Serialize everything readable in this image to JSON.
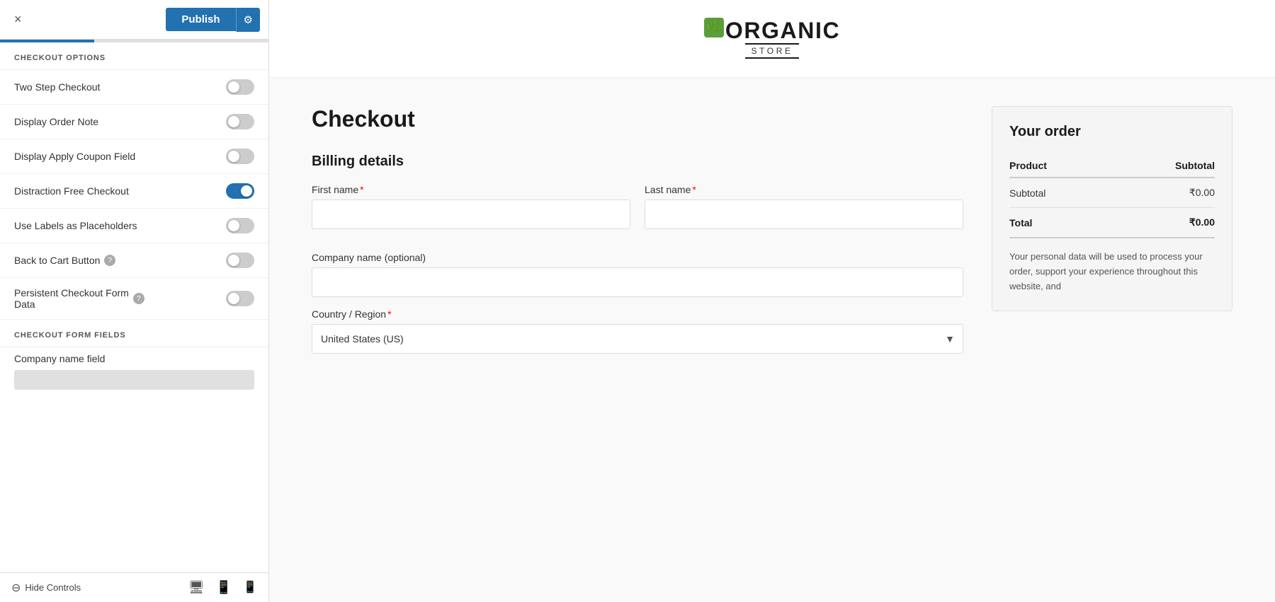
{
  "topbar": {
    "close_label": "×",
    "publish_label": "Publish",
    "gear_label": "⚙"
  },
  "sidebar": {
    "section1_title": "CHECKOUT OPTIONS",
    "section2_title": "CHECKOUT FORM FIELDS",
    "toggles": [
      {
        "id": "two-step",
        "label": "Two Step Checkout",
        "on": false,
        "help": false
      },
      {
        "id": "display-order-note",
        "label": "Display Order Note",
        "on": false,
        "help": false
      },
      {
        "id": "display-apply-coupon",
        "label": "Display Apply Coupon Field",
        "on": false,
        "help": false
      },
      {
        "id": "distraction-free",
        "label": "Distraction Free Checkout",
        "on": true,
        "help": false
      },
      {
        "id": "use-labels",
        "label": "Use Labels as Placeholders",
        "on": false,
        "help": false
      },
      {
        "id": "back-to-cart",
        "label": "Back to Cart Button",
        "on": false,
        "help": true
      },
      {
        "id": "persistent-checkout",
        "label": "Persistent Checkout Form Data",
        "on": false,
        "help": true
      }
    ],
    "form_fields_label": "Company name field",
    "hide_controls_label": "Hide Controls"
  },
  "header": {
    "logo_leaf": "🌿",
    "logo_name": "ORGANIC",
    "logo_store": "STORE"
  },
  "checkout": {
    "title": "Checkout",
    "billing_title": "Billing details",
    "fields": {
      "first_name_label": "First name",
      "last_name_label": "Last name",
      "company_label": "Company name (optional)",
      "country_label": "Country / Region",
      "country_value": "United States (US)"
    }
  },
  "order": {
    "title": "Your order",
    "product_col": "Product",
    "subtotal_col": "Subtotal",
    "subtotal_label": "Subtotal",
    "subtotal_value": "₹0.00",
    "total_label": "Total",
    "total_value": "₹0.00",
    "privacy_text": "Your personal data will be used to process your order, support your experience throughout this website, and"
  }
}
